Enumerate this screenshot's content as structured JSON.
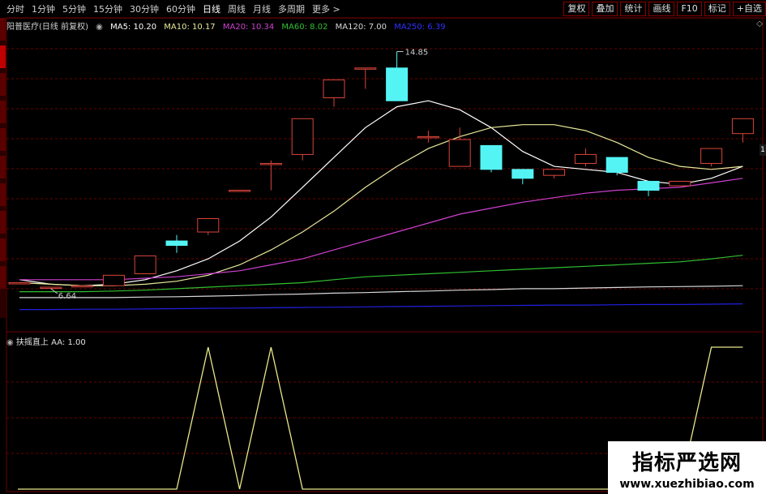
{
  "periods": {
    "items": [
      "分时",
      "1分钟",
      "5分钟",
      "15分钟",
      "30分钟",
      "60分钟",
      "日线",
      "周线",
      "月线",
      "多周期",
      "更多 >"
    ],
    "active": "日线"
  },
  "tools": [
    "复权",
    "叠加",
    "统计",
    "画线",
    "F10",
    "标记",
    "+自选"
  ],
  "main_legend": {
    "title": "阳普医疗(日线 前复权)",
    "ma5": "MA5: 10.20",
    "ma10": "MA10: 10.17",
    "ma20": "MA20: 10.34",
    "ma60": "MA60: 8.02",
    "ma120": "MA120: 7.00",
    "ma250": "MA250: 6.39"
  },
  "colors": {
    "up": "#d9453a",
    "down": "#54f4f4",
    "ma5": "#ffffff",
    "ma10": "#e8e89a",
    "ma20": "#d040d0",
    "ma60": "#30c030",
    "ma120": "#d8d8d8",
    "ma250": "#2020e0",
    "indicator": "#e8e88a",
    "grid": "#6b0000"
  },
  "price_labels": {
    "high": "14.85",
    "low": "6.64"
  },
  "right_marker": "1",
  "sub_legend": {
    "name": "扶摇直上",
    "value": "AA: 1.00"
  },
  "watermark": {
    "title": "指标严选网",
    "url": "www.xuezhibiao.com"
  },
  "chart_data": {
    "type": "line",
    "candles": [
      {
        "x": 0,
        "open": 7.1,
        "close": 7.1,
        "high": 7.1,
        "low": 7.1
      },
      {
        "x": 1,
        "open": 6.92,
        "close": 6.95,
        "high": 6.95,
        "low": 6.9
      },
      {
        "x": 2,
        "open": 6.98,
        "close": 7.0,
        "high": 7.0,
        "low": 6.96
      },
      {
        "x": 3,
        "open": 7.0,
        "close": 7.35,
        "high": 7.35,
        "low": 7.0
      },
      {
        "x": 4,
        "open": 7.4,
        "close": 8.0,
        "high": 8.0,
        "low": 7.4
      },
      {
        "x": 5,
        "open": 8.5,
        "close": 8.35,
        "high": 8.7,
        "low": 8.1
      },
      {
        "x": 6,
        "open": 8.8,
        "close": 9.25,
        "high": 9.25,
        "low": 8.7
      },
      {
        "x": 7,
        "open": 10.2,
        "close": 10.2,
        "high": 10.2,
        "low": 10.2
      },
      {
        "x": 8,
        "open": 11.1,
        "close": 11.1,
        "high": 11.2,
        "low": 10.2
      },
      {
        "x": 9,
        "open": 11.4,
        "close": 12.6,
        "high": 12.6,
        "low": 11.2
      },
      {
        "x": 10,
        "open": 13.3,
        "close": 13.9,
        "high": 13.9,
        "low": 13.0
      },
      {
        "x": 11,
        "open": 14.3,
        "close": 14.3,
        "high": 14.3,
        "low": 13.6
      },
      {
        "x": 12,
        "open": 14.3,
        "close": 13.2,
        "high": 14.85,
        "low": 13.2
      },
      {
        "x": 13,
        "open": 12.0,
        "close": 12.0,
        "high": 12.2,
        "low": 11.8
      },
      {
        "x": 14,
        "open": 11.0,
        "close": 11.9,
        "high": 12.3,
        "low": 11.0
      },
      {
        "x": 15,
        "open": 11.7,
        "close": 10.9,
        "high": 11.7,
        "low": 10.8
      },
      {
        "x": 16,
        "open": 10.9,
        "close": 10.6,
        "high": 10.9,
        "low": 10.4
      },
      {
        "x": 17,
        "open": 10.7,
        "close": 10.9,
        "high": 10.9,
        "low": 10.6
      },
      {
        "x": 18,
        "open": 11.1,
        "close": 11.4,
        "high": 11.6,
        "low": 11.0
      },
      {
        "x": 19,
        "open": 11.3,
        "close": 10.8,
        "high": 11.3,
        "low": 10.7
      },
      {
        "x": 20,
        "open": 10.5,
        "close": 10.2,
        "high": 10.5,
        "low": 10.0
      },
      {
        "x": 21,
        "open": 10.35,
        "close": 10.5,
        "high": 10.5,
        "low": 10.35
      },
      {
        "x": 22,
        "open": 11.1,
        "close": 11.6,
        "high": 11.6,
        "low": 11.0
      },
      {
        "x": 23,
        "open": 12.1,
        "close": 12.6,
        "high": 12.6,
        "low": 11.8
      }
    ],
    "ma_lines": {
      "ma5": [
        7.2,
        7.05,
        7.0,
        7.05,
        7.2,
        7.5,
        7.9,
        8.5,
        9.3,
        10.3,
        11.3,
        12.3,
        13.0,
        13.2,
        12.9,
        12.3,
        11.5,
        11.0,
        10.9,
        10.8,
        10.5,
        10.4,
        10.6,
        11.0
      ],
      "ma10": [
        7.1,
        7.05,
        7.0,
        7.0,
        7.05,
        7.15,
        7.35,
        7.7,
        8.2,
        8.8,
        9.5,
        10.3,
        11.0,
        11.6,
        12.0,
        12.3,
        12.4,
        12.4,
        12.2,
        11.8,
        11.3,
        11.0,
        10.9,
        11.0
      ],
      "ma20": [
        7.2,
        7.2,
        7.2,
        7.2,
        7.25,
        7.3,
        7.4,
        7.5,
        7.7,
        7.9,
        8.2,
        8.5,
        8.8,
        9.1,
        9.4,
        9.6,
        9.8,
        9.95,
        10.1,
        10.2,
        10.25,
        10.3,
        10.45,
        10.6
      ],
      "ma60": [
        6.8,
        6.8,
        6.8,
        6.82,
        6.85,
        6.9,
        6.95,
        7.0,
        7.05,
        7.1,
        7.2,
        7.3,
        7.35,
        7.4,
        7.45,
        7.5,
        7.55,
        7.6,
        7.65,
        7.7,
        7.75,
        7.8,
        7.9,
        8.02
      ],
      "ma120": [
        6.6,
        6.6,
        6.6,
        6.6,
        6.62,
        6.63,
        6.65,
        6.67,
        6.7,
        6.72,
        6.75,
        6.77,
        6.8,
        6.82,
        6.85,
        6.87,
        6.9,
        6.9,
        6.92,
        6.94,
        6.96,
        6.97,
        6.98,
        7.0
      ],
      "ma250": [
        6.2,
        6.2,
        6.21,
        6.21,
        6.22,
        6.23,
        6.24,
        6.25,
        6.26,
        6.27,
        6.28,
        6.29,
        6.3,
        6.31,
        6.32,
        6.33,
        6.34,
        6.35,
        6.35,
        6.36,
        6.37,
        6.37,
        6.38,
        6.39
      ]
    },
    "indicator_aa": [
      0,
      0,
      0,
      0,
      0,
      0,
      1,
      0,
      1,
      0,
      0,
      0,
      0,
      0,
      0,
      0,
      0,
      0,
      0,
      0,
      0,
      0,
      1,
      1
    ],
    "ylim": [
      5.7,
      15.6
    ],
    "sub_ylim": [
      0,
      1
    ]
  }
}
